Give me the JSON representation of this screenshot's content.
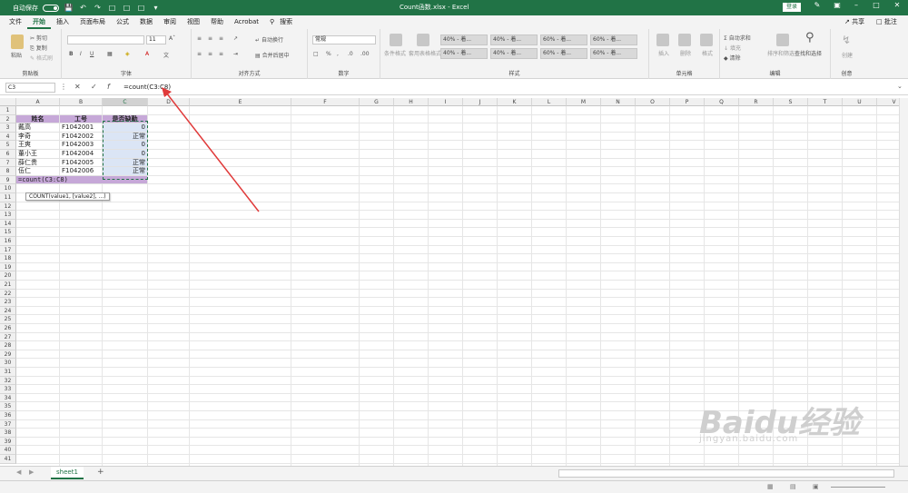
{
  "titlebar": {
    "autosave_label": "自动保存",
    "autosave_state": "关",
    "title": "Count函数.xlsx  -  Excel",
    "login_label": "登录"
  },
  "menu": {
    "tabs": [
      "文件",
      "开始",
      "插入",
      "页面布局",
      "公式",
      "数据",
      "审阅",
      "视图",
      "帮助",
      "Acrobat"
    ],
    "search": "搜索",
    "share": "共享",
    "comment": "批注"
  },
  "ribbon": {
    "clipboard": {
      "paste": "粘贴",
      "cut": "剪切",
      "copy": "复制",
      "format_painter": "格式刷",
      "group": "剪贴板"
    },
    "font": {
      "size": "11",
      "group": "字体"
    },
    "alignment": {
      "wrap": "自动换行",
      "merge": "合并后居中",
      "group": "对齐方式"
    },
    "number": {
      "format": "常规",
      "group": "数字"
    },
    "styles": {
      "conditional": "条件格式",
      "table": "套用表格格式",
      "cells": [
        "40% - 着...",
        "40% - 着...",
        "60% - 着...",
        "60% - 着...",
        "40% - 着...",
        "40% - 着...",
        "60% - 着...",
        "60% - 着..."
      ],
      "group": "样式"
    },
    "cells_group": {
      "insert": "插入",
      "delete": "删除",
      "format": "格式",
      "group": "单元格"
    },
    "editing": {
      "autosum": "自动求和",
      "fill": "填充",
      "clear": "清除",
      "sort": "排序和筛选",
      "find": "查找和选择",
      "group": "编辑"
    },
    "create": {
      "label": "创建",
      "group": "创意"
    }
  },
  "formula_bar": {
    "name_box": "C3",
    "formula": "=count(C3:C8)"
  },
  "grid": {
    "columns": [
      "A",
      "B",
      "C",
      "D",
      "E",
      "F",
      "G",
      "H",
      "I",
      "J",
      "K",
      "L",
      "M",
      "N",
      "O",
      "P",
      "Q",
      "R",
      "S",
      "T",
      "U",
      "V"
    ],
    "rows": [
      "1",
      "2",
      "3",
      "4",
      "5",
      "6",
      "7",
      "8",
      "9",
      "10",
      "11",
      "12",
      "13",
      "14",
      "15",
      "16",
      "17",
      "18",
      "19",
      "20",
      "21",
      "22",
      "23",
      "24",
      "25",
      "26",
      "27",
      "28",
      "29",
      "30",
      "31",
      "32",
      "33",
      "34",
      "35",
      "36",
      "37",
      "38",
      "39",
      "40",
      "41"
    ],
    "header_cells": [
      "姓名",
      "工号",
      "是否缺勤"
    ],
    "data_rows": [
      [
        "戴高",
        "F1042001",
        "0"
      ],
      [
        "李奇",
        "F1042002",
        "正常"
      ],
      [
        "王爽",
        "F1042003",
        "0"
      ],
      [
        "董小王",
        "F1042004",
        "0"
      ],
      [
        "薛仁贵",
        "F1042005",
        "正常"
      ],
      [
        "伍仁",
        "F1042006",
        "正常"
      ]
    ],
    "editing_cell": "=count(C3:C8)",
    "tooltip": "COUNT(value1, [value2], ...)"
  },
  "sheet": {
    "tab": "sheet1",
    "add": "+"
  },
  "colors": {
    "excel_green": "#217346",
    "header_fill": "#c6a8d8",
    "selection": "#dbe5f5",
    "arrow": "#e03a3a"
  },
  "watermark": {
    "brand": "Baidu经验",
    "url": "jingyan.baidu.com"
  }
}
